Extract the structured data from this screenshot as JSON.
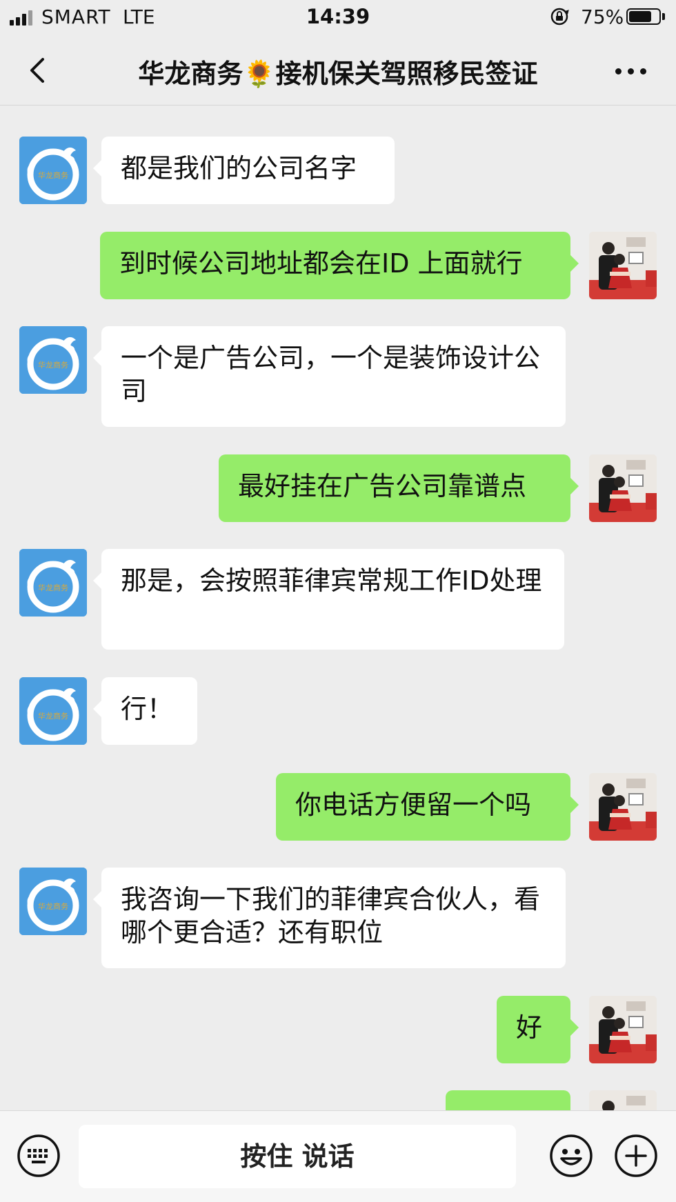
{
  "status_bar": {
    "carrier": "SMART",
    "network": "LTE",
    "time": "14:39",
    "battery_percent": "75%",
    "battery_level": 0.75
  },
  "nav": {
    "title": "华龙商务🌻接机保关驾照移民签证",
    "back_icon": "chevron-left-icon",
    "more_icon": "more-dots-icon"
  },
  "contact_logo_text": "华龙商务",
  "messages": [
    {
      "side": "in",
      "text": "都是我们的公司名字"
    },
    {
      "side": "out",
      "text": "到时候公司地址都会在ID 上面就行"
    },
    {
      "side": "in",
      "text": "一个是广告公司，一个是装饰设计公司"
    },
    {
      "side": "out",
      "text": "最好挂在广告公司靠谱点"
    },
    {
      "side": "in",
      "text": "那是，会按照菲律宾常规工作ID处理"
    },
    {
      "side": "in",
      "text": "行！"
    },
    {
      "side": "out",
      "text": "你电话方便留一个吗"
    },
    {
      "side": "in",
      "text": "我咨询一下我们的菲律宾合伙人，看哪个更合适？还有职位"
    },
    {
      "side": "out",
      "text": "好"
    },
    {
      "side": "out",
      "text": ""
    }
  ],
  "input_bar": {
    "hold_to_talk": "按住 说话",
    "keyboard_icon": "keyboard-icon",
    "emoji_icon": "emoji-icon",
    "plus_icon": "plus-icon"
  },
  "colors": {
    "background": "#ededed",
    "incoming_bubble": "#ffffff",
    "outgoing_bubble": "#95ec69",
    "logo_blue": "#4b9ee0"
  }
}
